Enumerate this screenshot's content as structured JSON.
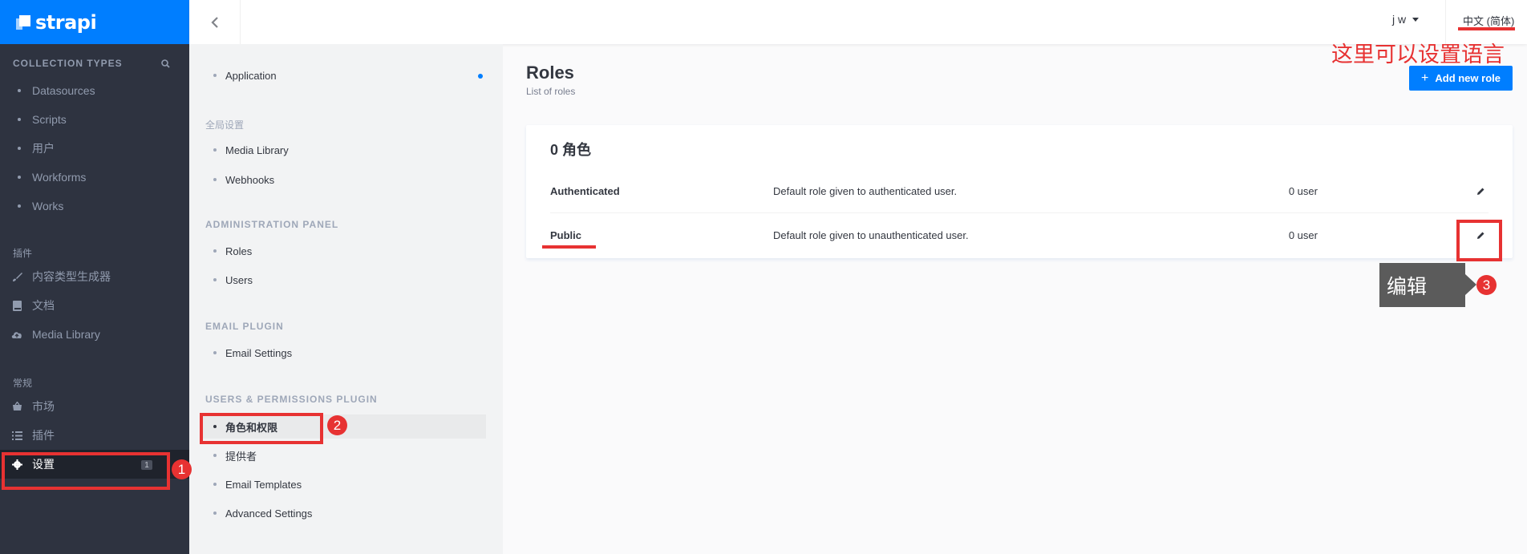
{
  "brand": {
    "name": "strapi"
  },
  "leftnav": {
    "collection_types_heading": "COLLECTION TYPES",
    "collection_types": [
      "Datasources",
      "Scripts",
      "用户",
      "Workforms",
      "Works"
    ],
    "plugins_heading": "插件",
    "plugins": [
      {
        "label": "内容类型生成器",
        "icon": "brush-icon"
      },
      {
        "label": "文档",
        "icon": "book-icon"
      },
      {
        "label": "Media Library",
        "icon": "cloud-upload-icon"
      }
    ],
    "general_heading": "常规",
    "general": [
      {
        "label": "市场",
        "icon": "shop-icon"
      },
      {
        "label": "插件",
        "icon": "list-icon"
      },
      {
        "label": "设置",
        "icon": "gear-icon",
        "badge": "1"
      }
    ]
  },
  "header": {
    "user": "j w",
    "language": "中文 (简体)"
  },
  "subnav": {
    "application": "Application",
    "global_heading": "全局设置",
    "global_items": [
      "Media Library",
      "Webhooks"
    ],
    "admin_heading": "ADMINISTRATION PANEL",
    "admin_items": [
      "Roles",
      "Users"
    ],
    "email_heading": "EMAIL PLUGIN",
    "email_items": [
      "Email Settings"
    ],
    "users_heading": "USERS & PERMISSIONS PLUGIN",
    "users_items": [
      "角色和权限",
      "提供者",
      "Email Templates",
      "Advanced Settings"
    ]
  },
  "main": {
    "title": "Roles",
    "subtitle": "List of roles",
    "add_button": "Add new role",
    "card_title": "0 角色",
    "roles": [
      {
        "name": "Authenticated",
        "description": "Default role given to authenticated user.",
        "users": "0 user"
      },
      {
        "name": "Public",
        "description": "Default role given to unauthenticated user.",
        "users": "0 user"
      }
    ]
  },
  "annotations": {
    "language_note": "这里可以设置语言",
    "edit_note": "编辑",
    "step1": "1",
    "step2": "2",
    "step3": "3",
    "accent": "#e73232"
  }
}
